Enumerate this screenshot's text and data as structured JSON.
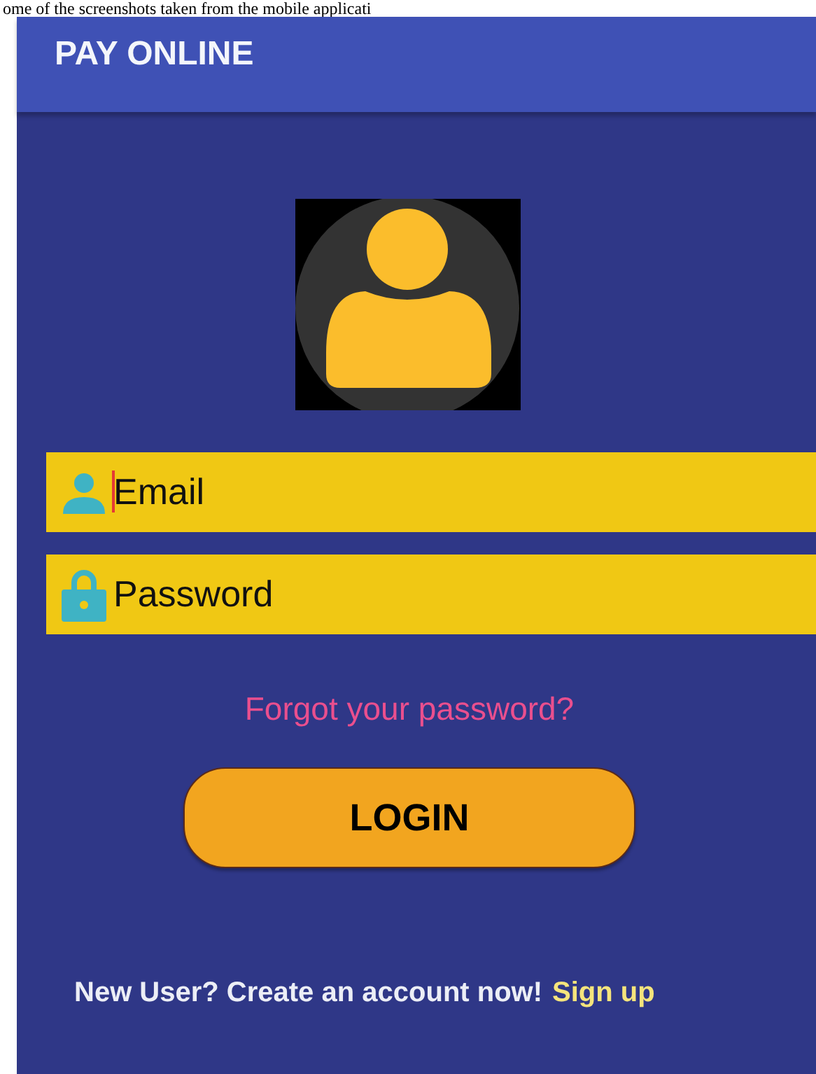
{
  "caption": "ome of the screenshots taken from the mobile applicati",
  "app_bar": {
    "title": "PAY ONLINE"
  },
  "fields": [
    {
      "kind": "person",
      "placeholder": "Email",
      "focused": true
    },
    {
      "kind": "lock",
      "placeholder": "Password",
      "focused": false
    }
  ],
  "forgot_link": "Forgot your password?",
  "login_button": "LOGIN",
  "footer": {
    "text": "New User? Create an account now!",
    "link": "Sign up"
  }
}
